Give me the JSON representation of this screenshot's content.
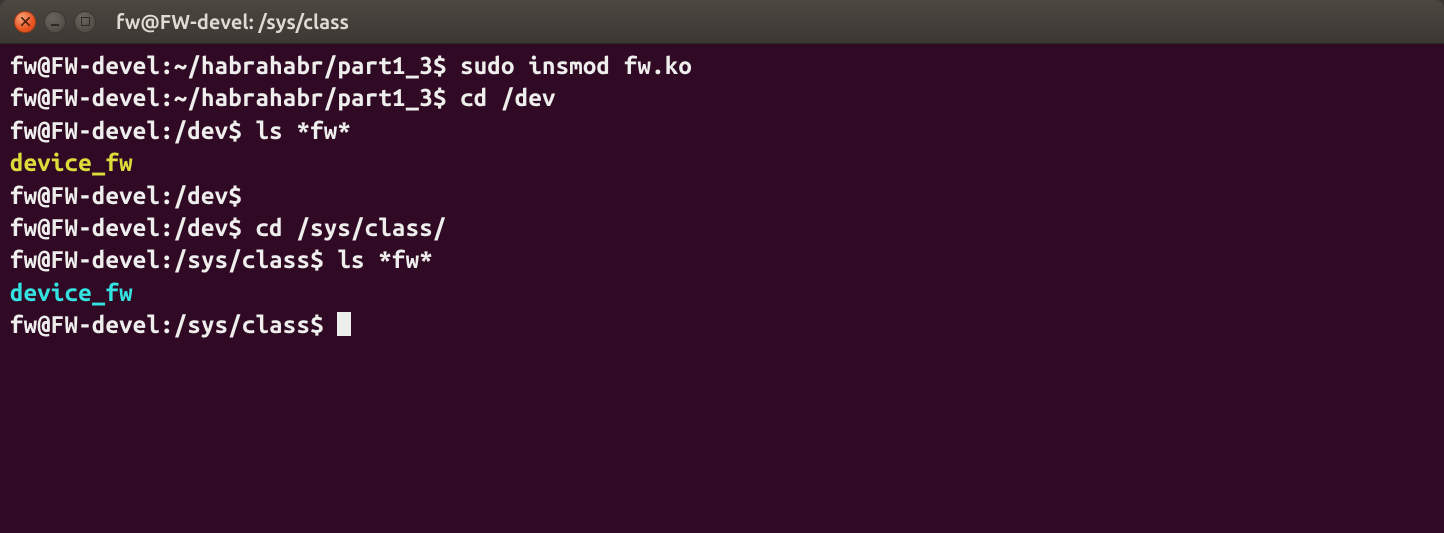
{
  "window": {
    "title": "fw@FW-devel: /sys/class"
  },
  "icons": {
    "close": "close-icon",
    "minimize": "minimize-icon",
    "maximize": "maximize-icon"
  },
  "lines": [
    {
      "prompt_user": "fw@FW-devel",
      "prompt_path": "~/habrahabr/part1_3",
      "command": "sudo insmod fw.ko"
    },
    {
      "prompt_user": "fw@FW-devel",
      "prompt_path": "~/habrahabr/part1_3",
      "command": "cd /dev"
    },
    {
      "prompt_user": "fw@FW-devel",
      "prompt_path": "/dev",
      "command": "ls *fw*"
    },
    {
      "output": "device_fw",
      "style": "yellow"
    },
    {
      "prompt_user": "fw@FW-devel",
      "prompt_path": "/dev",
      "command": ""
    },
    {
      "prompt_user": "fw@FW-devel",
      "prompt_path": "/dev",
      "command": "cd /sys/class/"
    },
    {
      "prompt_user": "fw@FW-devel",
      "prompt_path": "/sys/class",
      "command": "ls *fw*"
    },
    {
      "output": "device_fw",
      "style": "cyan"
    },
    {
      "prompt_user": "fw@FW-devel",
      "prompt_path": "/sys/class",
      "command": "",
      "cursor": true
    }
  ],
  "prompt": {
    "sep": ":",
    "dollar": "$"
  }
}
